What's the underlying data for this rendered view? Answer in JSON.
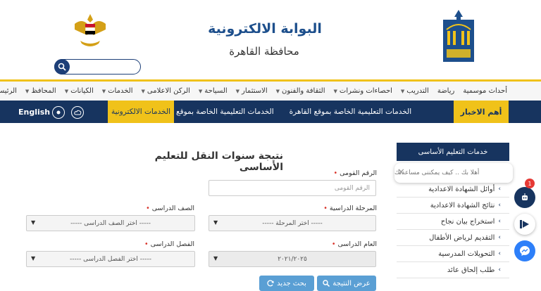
{
  "header": {
    "title": "البوابة الالكترونية",
    "subtitle": "محافظة القاهرة",
    "search_placeholder": ""
  },
  "nav": {
    "items": [
      {
        "label": "الرئيسية",
        "has_caret": false
      },
      {
        "label": "المحافظ",
        "has_caret": true
      },
      {
        "label": "الكيانات",
        "has_caret": true
      },
      {
        "label": "الخدمات",
        "has_caret": true
      },
      {
        "label": "الركن الاعلامى",
        "has_caret": true
      },
      {
        "label": "السياحة",
        "has_caret": true
      },
      {
        "label": "الاستثمار",
        "has_caret": true
      },
      {
        "label": "الثقافة والفنون",
        "has_caret": true
      },
      {
        "label": "احصاءات ونشرات",
        "has_caret": true
      },
      {
        "label": "التدريب",
        "has_caret": true
      },
      {
        "label": "رياضة",
        "has_caret": false
      },
      {
        "label": "أحداث موسمية",
        "has_caret": false
      }
    ]
  },
  "newsbar": {
    "label": "أهم الاخبار",
    "ticker": [
      "الخدمات التعليمية الخاصة بموقع القاهرة",
      "الخدمات التعليمية الخاصة بموقع"
    ],
    "eservices": "الخدمات الالكترونية",
    "language": "English"
  },
  "form": {
    "heading": "نتيجة سنوات النقل للتعليم الأساسى",
    "national_id": {
      "label": "الرقم القومى",
      "placeholder": "الرقم القومى"
    },
    "stage": {
      "label": "المرحلة الدراسية",
      "value": "----- اختر المرحلة -----"
    },
    "grade": {
      "label": "الصف الدراسى",
      "value": "----- اختر الصف الدراسى -----"
    },
    "year": {
      "label": "العام الدراسى",
      "value": "٢٠٢١/٢٠٢٥"
    },
    "term": {
      "label": "الفصل الدراسى",
      "value": "----- اختر الفصل الدراسى -----"
    },
    "submit_label": "عرض النتيجة",
    "reset_label": "بحث جديد"
  },
  "sidebar": {
    "header": "خدمات التعليم الأساسى",
    "items": [
      "أوائل الشهادة الاعدادية",
      "نتائج الشهادة الاعدادية",
      "استخراج بيان نجاح",
      "التقديم لرياض الأطفال",
      "التحويلات المدرسية",
      "طلب إلحاق عائد"
    ]
  },
  "chat": {
    "message": "أهلا بك .. كيف يمكننى مساعدتك",
    "badge_count": "1"
  },
  "colors": {
    "navy": "#17345f",
    "gold": "#f0c21a",
    "button_blue": "#5a9fd4"
  }
}
